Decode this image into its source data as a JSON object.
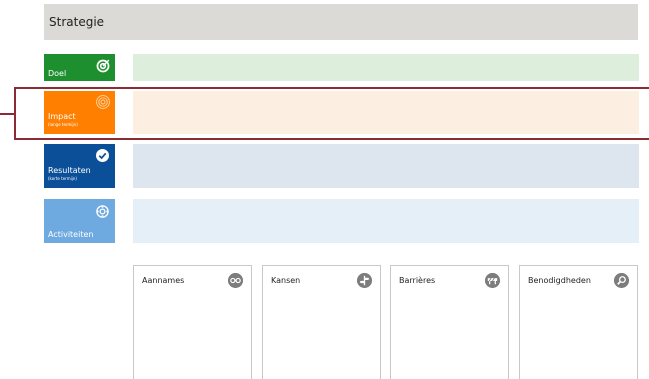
{
  "header": {
    "title": "Strategie"
  },
  "tiles": [
    {
      "label": "Doel",
      "sub": "",
      "icon": "target-icon",
      "color": "#1d8f2f",
      "bar_color": "#ddeedd"
    },
    {
      "label": "Impact",
      "sub": "(lange termijn)",
      "icon": "target-icon",
      "color": "#ff7f00",
      "bar_color": "#fdeee2"
    },
    {
      "label": "Resultaten",
      "sub": "(korte termijn)",
      "icon": "checkmark-icon",
      "color": "#0b4f98",
      "bar_color": "#dde6ef"
    },
    {
      "label": "Activiteiten",
      "sub": "",
      "icon": "gear-icon",
      "color": "#6ea9e0",
      "bar_color": "#e4eff8"
    }
  ],
  "cards": [
    {
      "title": "Aannames",
      "icon": "glasses-icon"
    },
    {
      "title": "Kansen",
      "icon": "signpost-icon"
    },
    {
      "title": "Barrières",
      "icon": "barrier-icon"
    },
    {
      "title": "Benodigdheden",
      "icon": "magnifier-icon"
    }
  ],
  "colors": {
    "highlight": "#8b2b36",
    "header_bg": "#dcdad6",
    "card_icon": "#7d7d7d"
  }
}
